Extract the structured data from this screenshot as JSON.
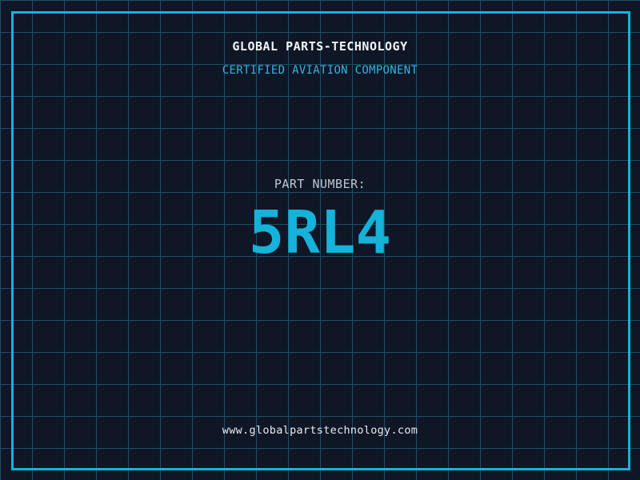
{
  "header": {
    "title": "GLOBAL PARTS-TECHNOLOGY",
    "subtitle": "CERTIFIED AVIATION COMPONENT"
  },
  "part": {
    "label": "PART NUMBER:",
    "number": "5RL4"
  },
  "footer": {
    "url": "www.globalpartstechnology.com"
  },
  "colors": {
    "background": "#0f1626",
    "grid_line": "#1c5064",
    "frame_accent": "#15b2da",
    "title_text": "#f2f5f8",
    "subtitle_text": "#33b4dc",
    "label_text": "#bfc8d2",
    "part_number_text": "#15b2da",
    "footer_text": "#e9edf1"
  }
}
